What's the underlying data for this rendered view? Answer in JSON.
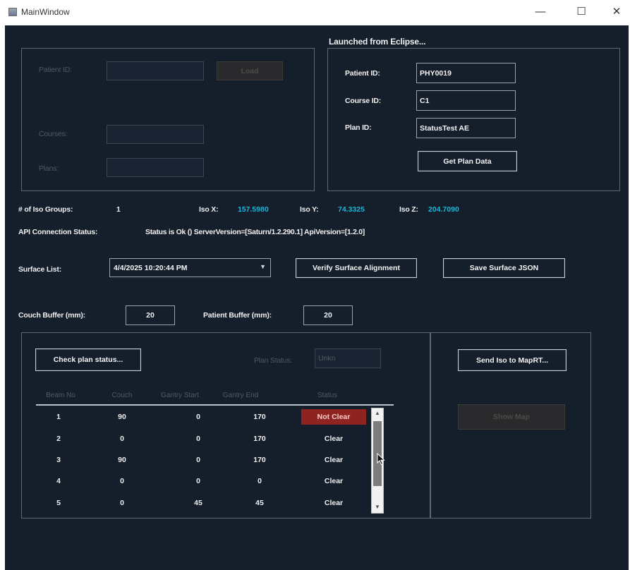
{
  "window": {
    "title": "MainWindow",
    "minimize": "—",
    "maximize": "☐",
    "close": "✕"
  },
  "load_panel": {
    "patient_id_label": "Patient ID:",
    "load_button": "Load",
    "courses_label": "Courses:",
    "plans_label": "Plans:"
  },
  "eclipse_panel": {
    "header": "Launched from Eclipse...",
    "patient_id_label": "Patient ID:",
    "patient_id_value": "PHY0019",
    "course_id_label": "Course ID:",
    "course_id_value": "C1",
    "plan_id_label": "Plan ID:",
    "plan_id_value": "StatusTest AE",
    "get_plan_button": "Get Plan Data"
  },
  "iso": {
    "groups_label": "# of Iso Groups:",
    "groups_value": "1",
    "x_label": "Iso X:",
    "x_value": "157.5980",
    "y_label": "Iso Y:",
    "y_value": "74.3325",
    "z_label": "Iso Z:",
    "z_value": "204.7090"
  },
  "api": {
    "label": "API Connection Status:",
    "value": "Status is Ok () ServerVersion=[Saturn/1.2.290.1] ApiVersion=[1.2.0]"
  },
  "surface": {
    "label": "Surface List:",
    "selected": "4/4/2025 10:20:44 PM",
    "verify_button": "Verify Surface Alignment",
    "save_button": "Save Surface JSON"
  },
  "buffers": {
    "couch_label": "Couch Buffer (mm):",
    "couch_value": "20",
    "patient_label": "Patient Buffer (mm):",
    "patient_value": "20"
  },
  "plan_status": {
    "check_button": "Check plan status...",
    "status_label": "Plan Status:",
    "status_value": "Unkn"
  },
  "grid": {
    "columns": [
      "Beam No",
      "Couch",
      "Gantry Start",
      "Gantry End",
      "Status"
    ],
    "rows": [
      {
        "beam": "1",
        "couch": "90",
        "start": "0",
        "end": "170",
        "status": "Not Clear"
      },
      {
        "beam": "2",
        "couch": "0",
        "start": "0",
        "end": "170",
        "status": "Clear"
      },
      {
        "beam": "3",
        "couch": "90",
        "start": "0",
        "end": "170",
        "status": "Clear"
      },
      {
        "beam": "4",
        "couch": "0",
        "start": "0",
        "end": "0",
        "status": "Clear"
      },
      {
        "beam": "5",
        "couch": "0",
        "start": "45",
        "end": "45",
        "status": "Clear"
      }
    ]
  },
  "maprt": {
    "send_button": "Send Iso to MapRT...",
    "show_map_button": "Show Map"
  },
  "colors": {
    "background": "#151e2b",
    "accent_cyan": "#19b6d8",
    "not_clear_red": "#8e2320"
  }
}
